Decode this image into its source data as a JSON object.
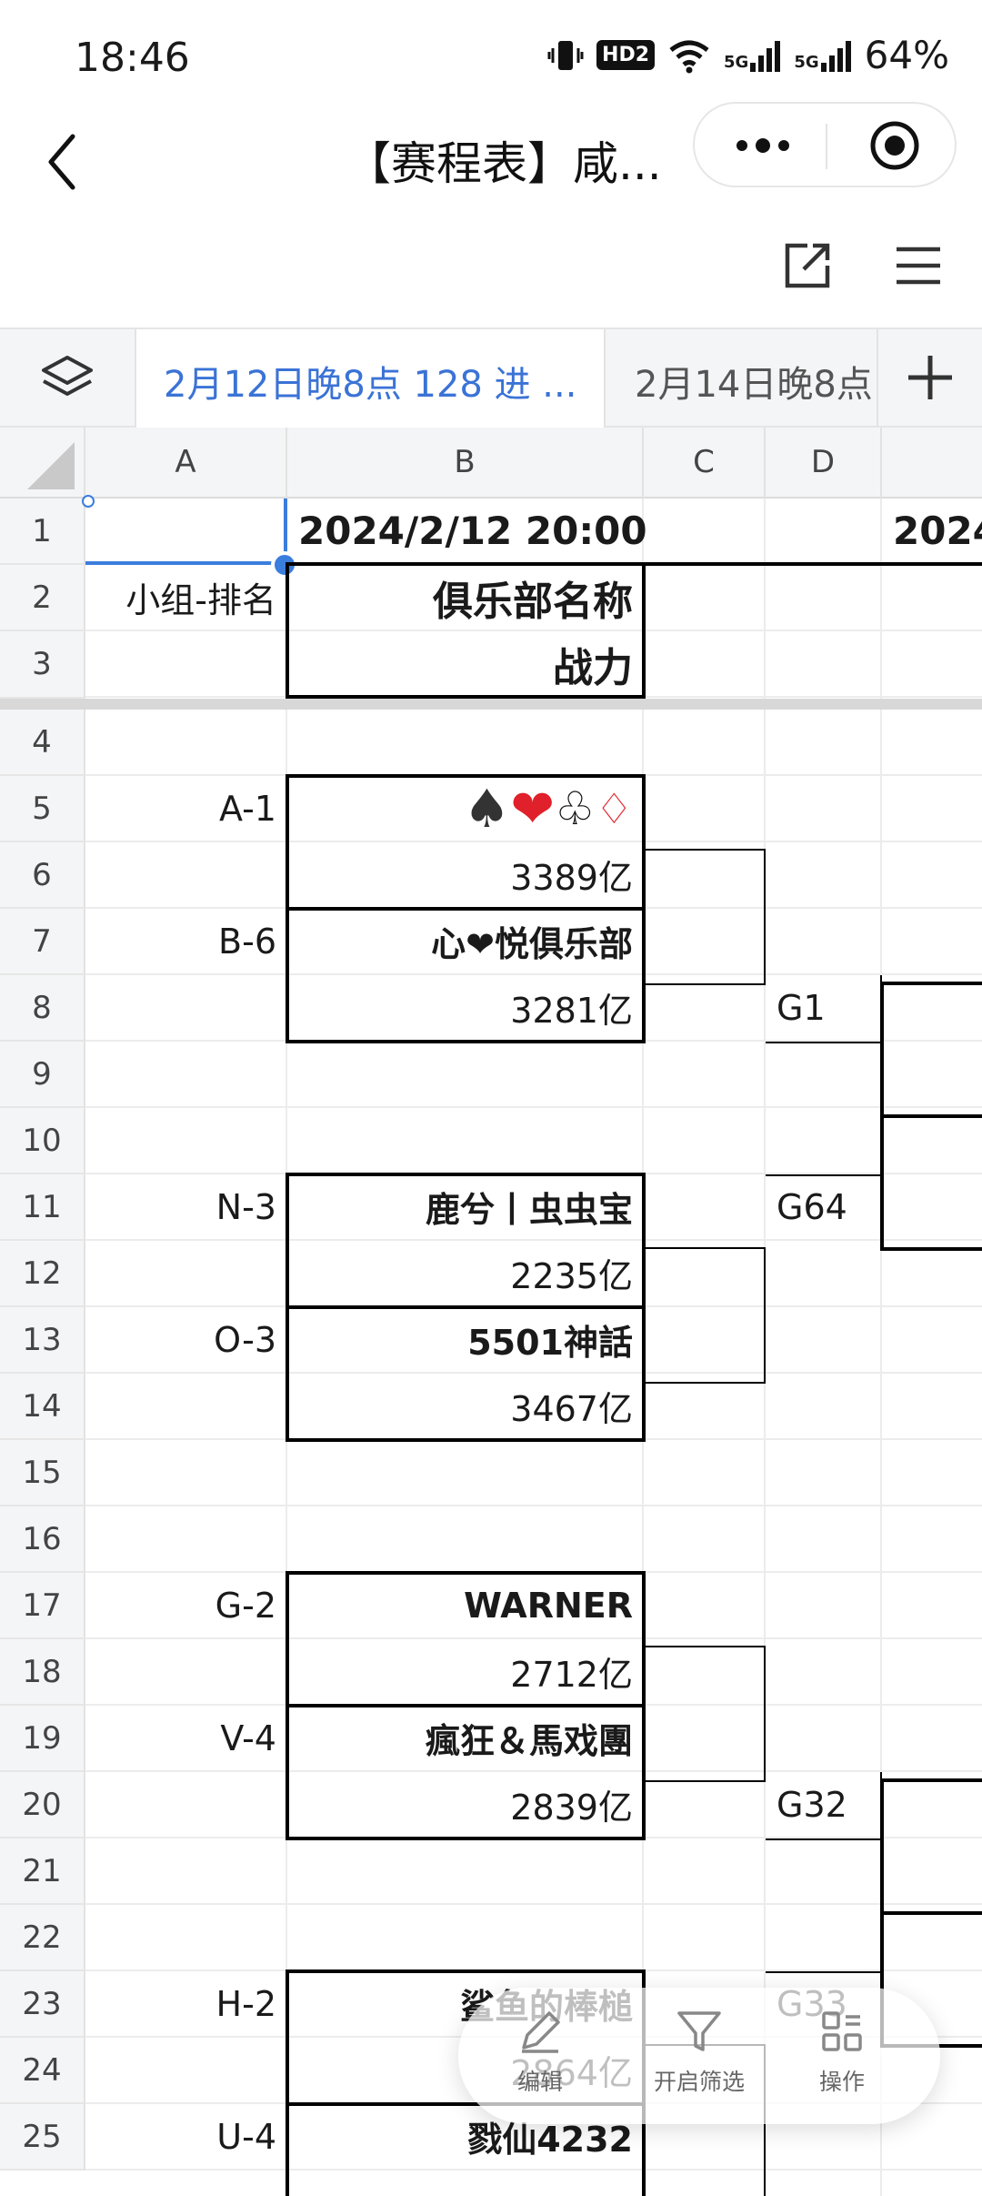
{
  "status_bar": {
    "time": "18:46",
    "battery": "64%",
    "hd_badge": "HD2",
    "net1": "5G",
    "net2": "5G"
  },
  "title_bar": {
    "title": "【赛程表】咸..."
  },
  "sheet_tabs": {
    "active": "2月12日晚8点 128 进 ...",
    "second": "2月14日晚8点"
  },
  "columns": [
    "A",
    "B",
    "C",
    "D"
  ],
  "rows": [
    "1",
    "2",
    "3",
    "4",
    "5",
    "6",
    "7",
    "8",
    "9",
    "10",
    "11",
    "12",
    "13",
    "14",
    "15",
    "16",
    "17",
    "18",
    "19",
    "20",
    "21",
    "22",
    "23",
    "24",
    "25"
  ],
  "cells": {
    "b1": "2024/2/12 20:00",
    "e1": "2024",
    "a2": "小组-排名",
    "b2": "俱乐部名称",
    "b3": "战力",
    "a5": "A-1",
    "b5": "♠❤♣♦",
    "b6": "3389亿",
    "a7": "B-6",
    "b7": "心❤悦俱乐部",
    "b8": "3281亿",
    "d8": "G1",
    "a11": "N-3",
    "b11": "鹿兮丨虫虫宝",
    "d11": "G64",
    "b12": "2235亿",
    "a13": "O-3",
    "b13": "5501神話",
    "b14": "3467亿",
    "a17": "G-2",
    "b17": "WARNER",
    "b18": "2712亿",
    "a19": "V-4",
    "b19": "瘋狂＆馬戏團",
    "b20": "2839亿",
    "d20": "G32",
    "a23": "H-2",
    "b23": "鲨鱼的棒槌",
    "d23": "G33",
    "b24": "2864亿",
    "a25": "U-4",
    "b25": "戮仙4232"
  },
  "float_toolbar": {
    "edit": "编辑",
    "filter": "开启筛选",
    "actions": "操作"
  }
}
